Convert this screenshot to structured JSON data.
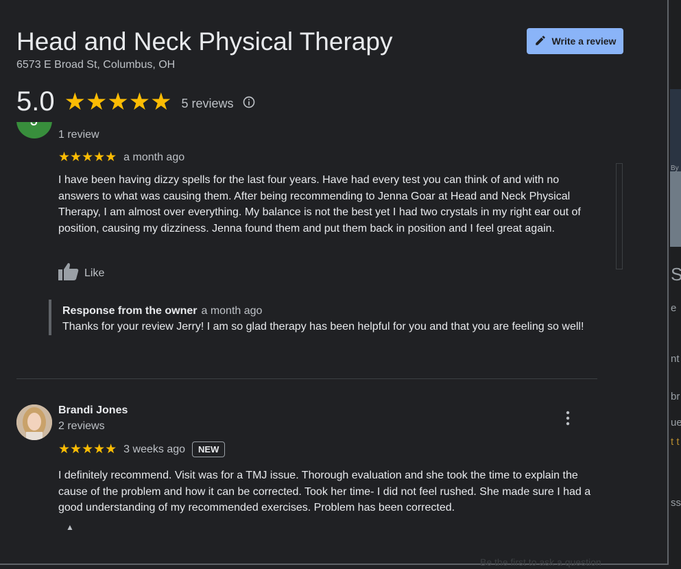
{
  "header": {
    "title": "Head and Neck Physical Therapy",
    "address": "6573 E Broad St, Columbus, OH",
    "write_review_label": "Write a review",
    "rating": "5.0",
    "stars": "★★★★★",
    "reviews_count": "5 reviews"
  },
  "reviews": [
    {
      "avatar_letter": "J",
      "reviewer_meta": "1 review",
      "stars": "★★★★★",
      "time": "a month ago",
      "text": "I have been having dizzy spells for the last four years. Have had every test you can think of and with no answers to what was causing them. After being recommending to Jenna Goar at Head and Neck Physical Therapy, I am almost over everything. My balance is not the best yet  I had two crystals in my right ear out of position, causing my dizziness. Jenna found them and put them back in position and I feel great again.",
      "like_label": "Like",
      "owner_response": {
        "label": "Response from the owner",
        "time": "a month ago",
        "text": "Thanks for your review Jerry! I am so glad therapy has been helpful for you and that you are feeling so well!"
      }
    },
    {
      "name": "Brandi Jones",
      "reviewer_meta": "2 reviews",
      "stars": "★★★★★",
      "time": "3 weeks ago",
      "badge": "NEW",
      "text": "I definitely recommend. Visit was for a TMJ issue. Thorough evaluation and she took the time to explain the cause of the problem and how it can be corrected. Took her time- I did not feel rushed. She made sure I had a good understanding of my recommended exercises. Problem has been corrected."
    }
  ],
  "background_fragments": {
    "by": "By",
    "s": "S",
    "e": "e",
    "nt": "nt",
    "br": "br",
    "ue": "ue",
    "t": "t t",
    "ss": "ss",
    "bottom": "Be the first to ask a question"
  },
  "colors": {
    "background": "#202124",
    "accent": "#8ab4f8",
    "star": "#fbbc04"
  }
}
